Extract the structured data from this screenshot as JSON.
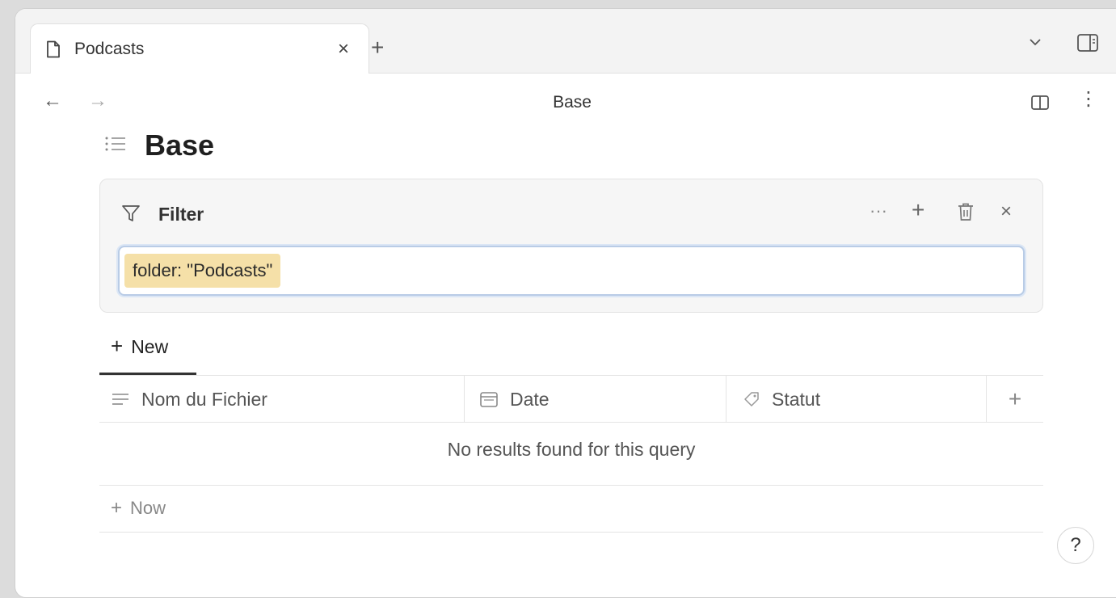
{
  "tab": {
    "label": "Podcasts",
    "close_label": "×",
    "new_tab_label": "+"
  },
  "nav": {
    "back_label": "←",
    "forward_label": "→",
    "view_title": "Base",
    "more_label": "⋮"
  },
  "page": {
    "title": "Base"
  },
  "filter": {
    "label": "Filter",
    "dots_label": "···",
    "add_label": "+",
    "close_label": "×",
    "query_token": "folder: \"Podcasts\""
  },
  "toolbar": {
    "new_label": "New",
    "plus": "+"
  },
  "table": {
    "columns": [
      {
        "label": "Nom du Fichier",
        "icon": "text-lines-icon"
      },
      {
        "label": "Date",
        "icon": "calendar-icon"
      },
      {
        "label": "Statut",
        "icon": "tag-icon"
      }
    ],
    "add_column_label": "+",
    "empty_message": "No results found for this query",
    "new_row_label": "Now",
    "new_row_plus": "+"
  },
  "help": {
    "label": "?"
  }
}
